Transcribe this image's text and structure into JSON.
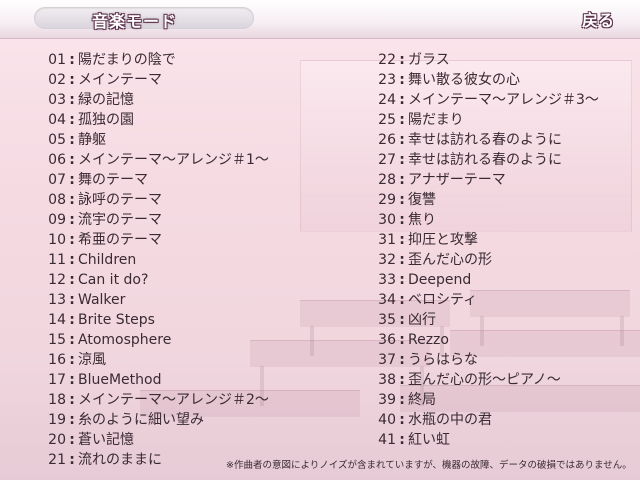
{
  "header": {
    "title": "音楽モード",
    "back_label": "戻る"
  },
  "tracks_left": [
    {
      "num": "01",
      "title": "陽だまりの陰で"
    },
    {
      "num": "02",
      "title": "メインテーマ"
    },
    {
      "num": "03",
      "title": "緑の記憶"
    },
    {
      "num": "04",
      "title": "孤独の園"
    },
    {
      "num": "05",
      "title": "静躯"
    },
    {
      "num": "06",
      "title": "メインテーマ〜アレンジ＃1〜"
    },
    {
      "num": "07",
      "title": "舞のテーマ"
    },
    {
      "num": "08",
      "title": "詠呼のテーマ"
    },
    {
      "num": "09",
      "title": "流宇のテーマ"
    },
    {
      "num": "10",
      "title": "希亜のテーマ"
    },
    {
      "num": "11",
      "title": "Children"
    },
    {
      "num": "12",
      "title": "Can it do?"
    },
    {
      "num": "13",
      "title": "Walker"
    },
    {
      "num": "14",
      "title": "Brite  Steps"
    },
    {
      "num": "15",
      "title": "Atomosphere"
    },
    {
      "num": "16",
      "title": "涼風"
    },
    {
      "num": "17",
      "title": "BlueMethod"
    },
    {
      "num": "18",
      "title": "メインテーマ〜アレンジ＃2〜"
    },
    {
      "num": "19",
      "title": "糸のように細い望み"
    },
    {
      "num": "20",
      "title": "蒼い記憶"
    },
    {
      "num": "21",
      "title": "流れのままに"
    }
  ],
  "tracks_right": [
    {
      "num": "22",
      "title": "ガラス"
    },
    {
      "num": "23",
      "title": "舞い散る彼女の心"
    },
    {
      "num": "24",
      "title": "メインテーマ〜アレンジ＃3〜"
    },
    {
      "num": "25",
      "title": "陽だまり"
    },
    {
      "num": "26",
      "title": "幸せは訪れる春のように"
    },
    {
      "num": "27",
      "title": "幸せは訪れる春のように"
    },
    {
      "num": "28",
      "title": "アナザーテーマ"
    },
    {
      "num": "29",
      "title": "復讐"
    },
    {
      "num": "30",
      "title": "焦り"
    },
    {
      "num": "31",
      "title": "抑圧と攻撃"
    },
    {
      "num": "32",
      "title": "歪んだ心の形"
    },
    {
      "num": "33",
      "title": "Deepend"
    },
    {
      "num": "34",
      "title": "ベロシティ"
    },
    {
      "num": "35",
      "title": "凶行"
    },
    {
      "num": "36",
      "title": "Rezzo"
    },
    {
      "num": "37",
      "title": "うらはらな"
    },
    {
      "num": "38",
      "title": "歪んだ心の形〜ピアノ〜"
    },
    {
      "num": "39",
      "title": "終局"
    },
    {
      "num": "40",
      "title": "水瓶の中の君"
    },
    {
      "num": "41",
      "title": "紅い虹"
    }
  ],
  "separator": ":",
  "footer": {
    "notice": "※作曲者の意図によりノイズが含まれていますが、機器の故障、データの破損ではありません。"
  }
}
